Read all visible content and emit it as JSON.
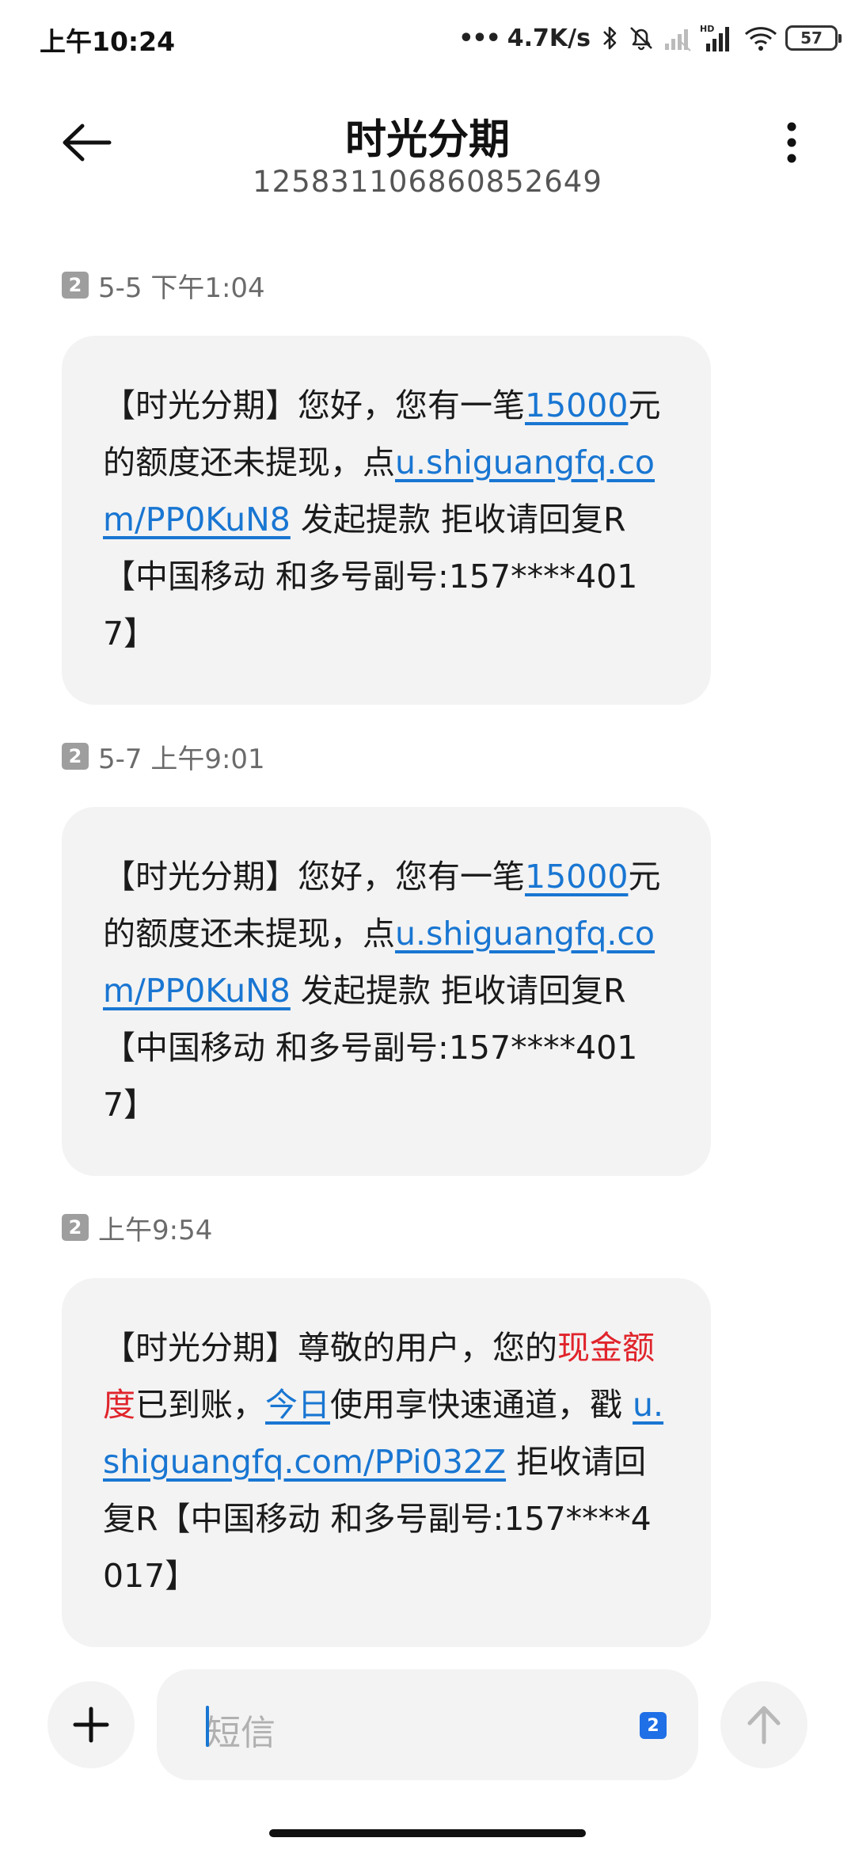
{
  "status_bar": {
    "time": "上午10:24",
    "dots": "•••",
    "network_speed": "4.7K/s",
    "battery": "57",
    "icons": [
      "bluetooth-icon",
      "mute-bell-icon",
      "signal-weak-icon",
      "signal-hd-icon",
      "wifi-icon",
      "battery-icon"
    ]
  },
  "header": {
    "title": "时光分期",
    "number": "125831106860852649",
    "icons": [
      "back-arrow-icon",
      "more-vertical-icon"
    ]
  },
  "messages": [
    {
      "sim": "2",
      "time": "5-5 下午1:04",
      "seg": {
        "t1": "【时光分期】您好，您有一笔",
        "amount": "15000",
        "t2": "元的额度还未提现，点",
        "url": "u.shiguangfq.com/PP0KuN8",
        "t3": " 发起提款 拒收请回复R【中国移动 和多号副号:157****4017】"
      }
    },
    {
      "sim": "2",
      "time": "5-7 上午9:01",
      "seg": {
        "t1": "【时光分期】您好，您有一笔",
        "amount": "15000",
        "t2": "元的额度还未提现，点",
        "url": "u.shiguangfq.com/PP0KuN8",
        "t3": " 发起提款 拒收请回复R【中国移动 和多号副号:157****4017】"
      }
    },
    {
      "sim": "2",
      "time": "上午9:54",
      "seg": {
        "t1": "【时光分期】尊敬的用户，您的",
        "red": "现金额度",
        "t2": "已到账，",
        "today": "今日",
        "t3": "使用享快速通道，戳 ",
        "url": "u.shiguangfq.com/PPi032Z",
        "t4": " 拒收请回复R【中国移动 和多号副号:157****4017】"
      }
    }
  ],
  "composer": {
    "placeholder": "短信",
    "sim": "2",
    "icons": [
      "plus-icon",
      "send-arrow-icon"
    ]
  },
  "colors": {
    "link": "#1976d2",
    "highlight_red": "#e0242b",
    "bubble_bg": "#f3f3f3",
    "sim_badge": "#9e9e9e",
    "sim_select": "#1f6fe6"
  }
}
